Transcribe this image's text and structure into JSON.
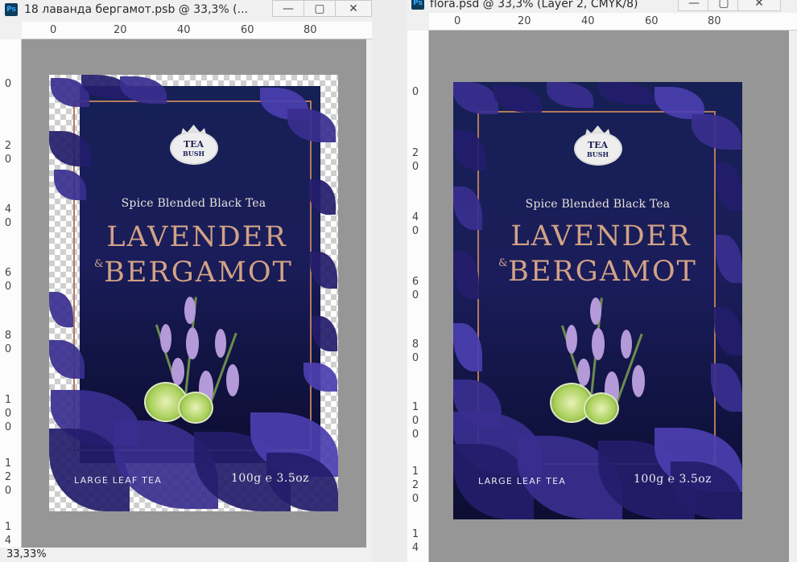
{
  "windows": [
    {
      "title": "18 лаванда бергамот.psb @ 33,3% (...",
      "app_icon": "Ps",
      "buttons": {
        "minimize": "—",
        "maximize": "▢",
        "close": "✕"
      },
      "ruler_h": [
        "0",
        "20",
        "40",
        "60",
        "80"
      ],
      "ruler_v": [
        [
          "0"
        ],
        [
          "2",
          "0"
        ],
        [
          "4",
          "0"
        ],
        [
          "6",
          "0"
        ],
        [
          "8",
          "0"
        ],
        [
          "1",
          "0",
          "0"
        ],
        [
          "1",
          "2",
          "0"
        ],
        [
          "1",
          "4"
        ]
      ],
      "zoom_status": "33,33%"
    },
    {
      "title": "flora.psd @ 33,3% (Layer 2, CMYK/8)",
      "app_icon": "Ps",
      "buttons": {
        "minimize": "—",
        "maximize": "▢",
        "close": "✕"
      },
      "ruler_h": [
        "0",
        "20",
        "40",
        "60",
        "80"
      ],
      "ruler_v": [
        [
          "0"
        ],
        [
          "2",
          "0"
        ],
        [
          "4",
          "0"
        ],
        [
          "6",
          "0"
        ],
        [
          "8",
          "0"
        ],
        [
          "1",
          "0",
          "0"
        ],
        [
          "1",
          "2",
          "0"
        ],
        [
          "1",
          "4"
        ]
      ]
    }
  ],
  "package": {
    "logo_top": "TEA",
    "logo_bottom": "BUSH",
    "subtitle": "Spice Blended Black Tea",
    "name_line1": "LAVENDER",
    "ampersand": "&",
    "name_line2": "BERGAMOT",
    "leaf_label": "LARGE LEAF TEA",
    "weight": "100g ℮ 3.5oz"
  },
  "colors": {
    "navy": "#1a1d5a",
    "copper": "#d3a286",
    "leaf": "#3a2f8f",
    "canvas_gray": "#969696"
  }
}
